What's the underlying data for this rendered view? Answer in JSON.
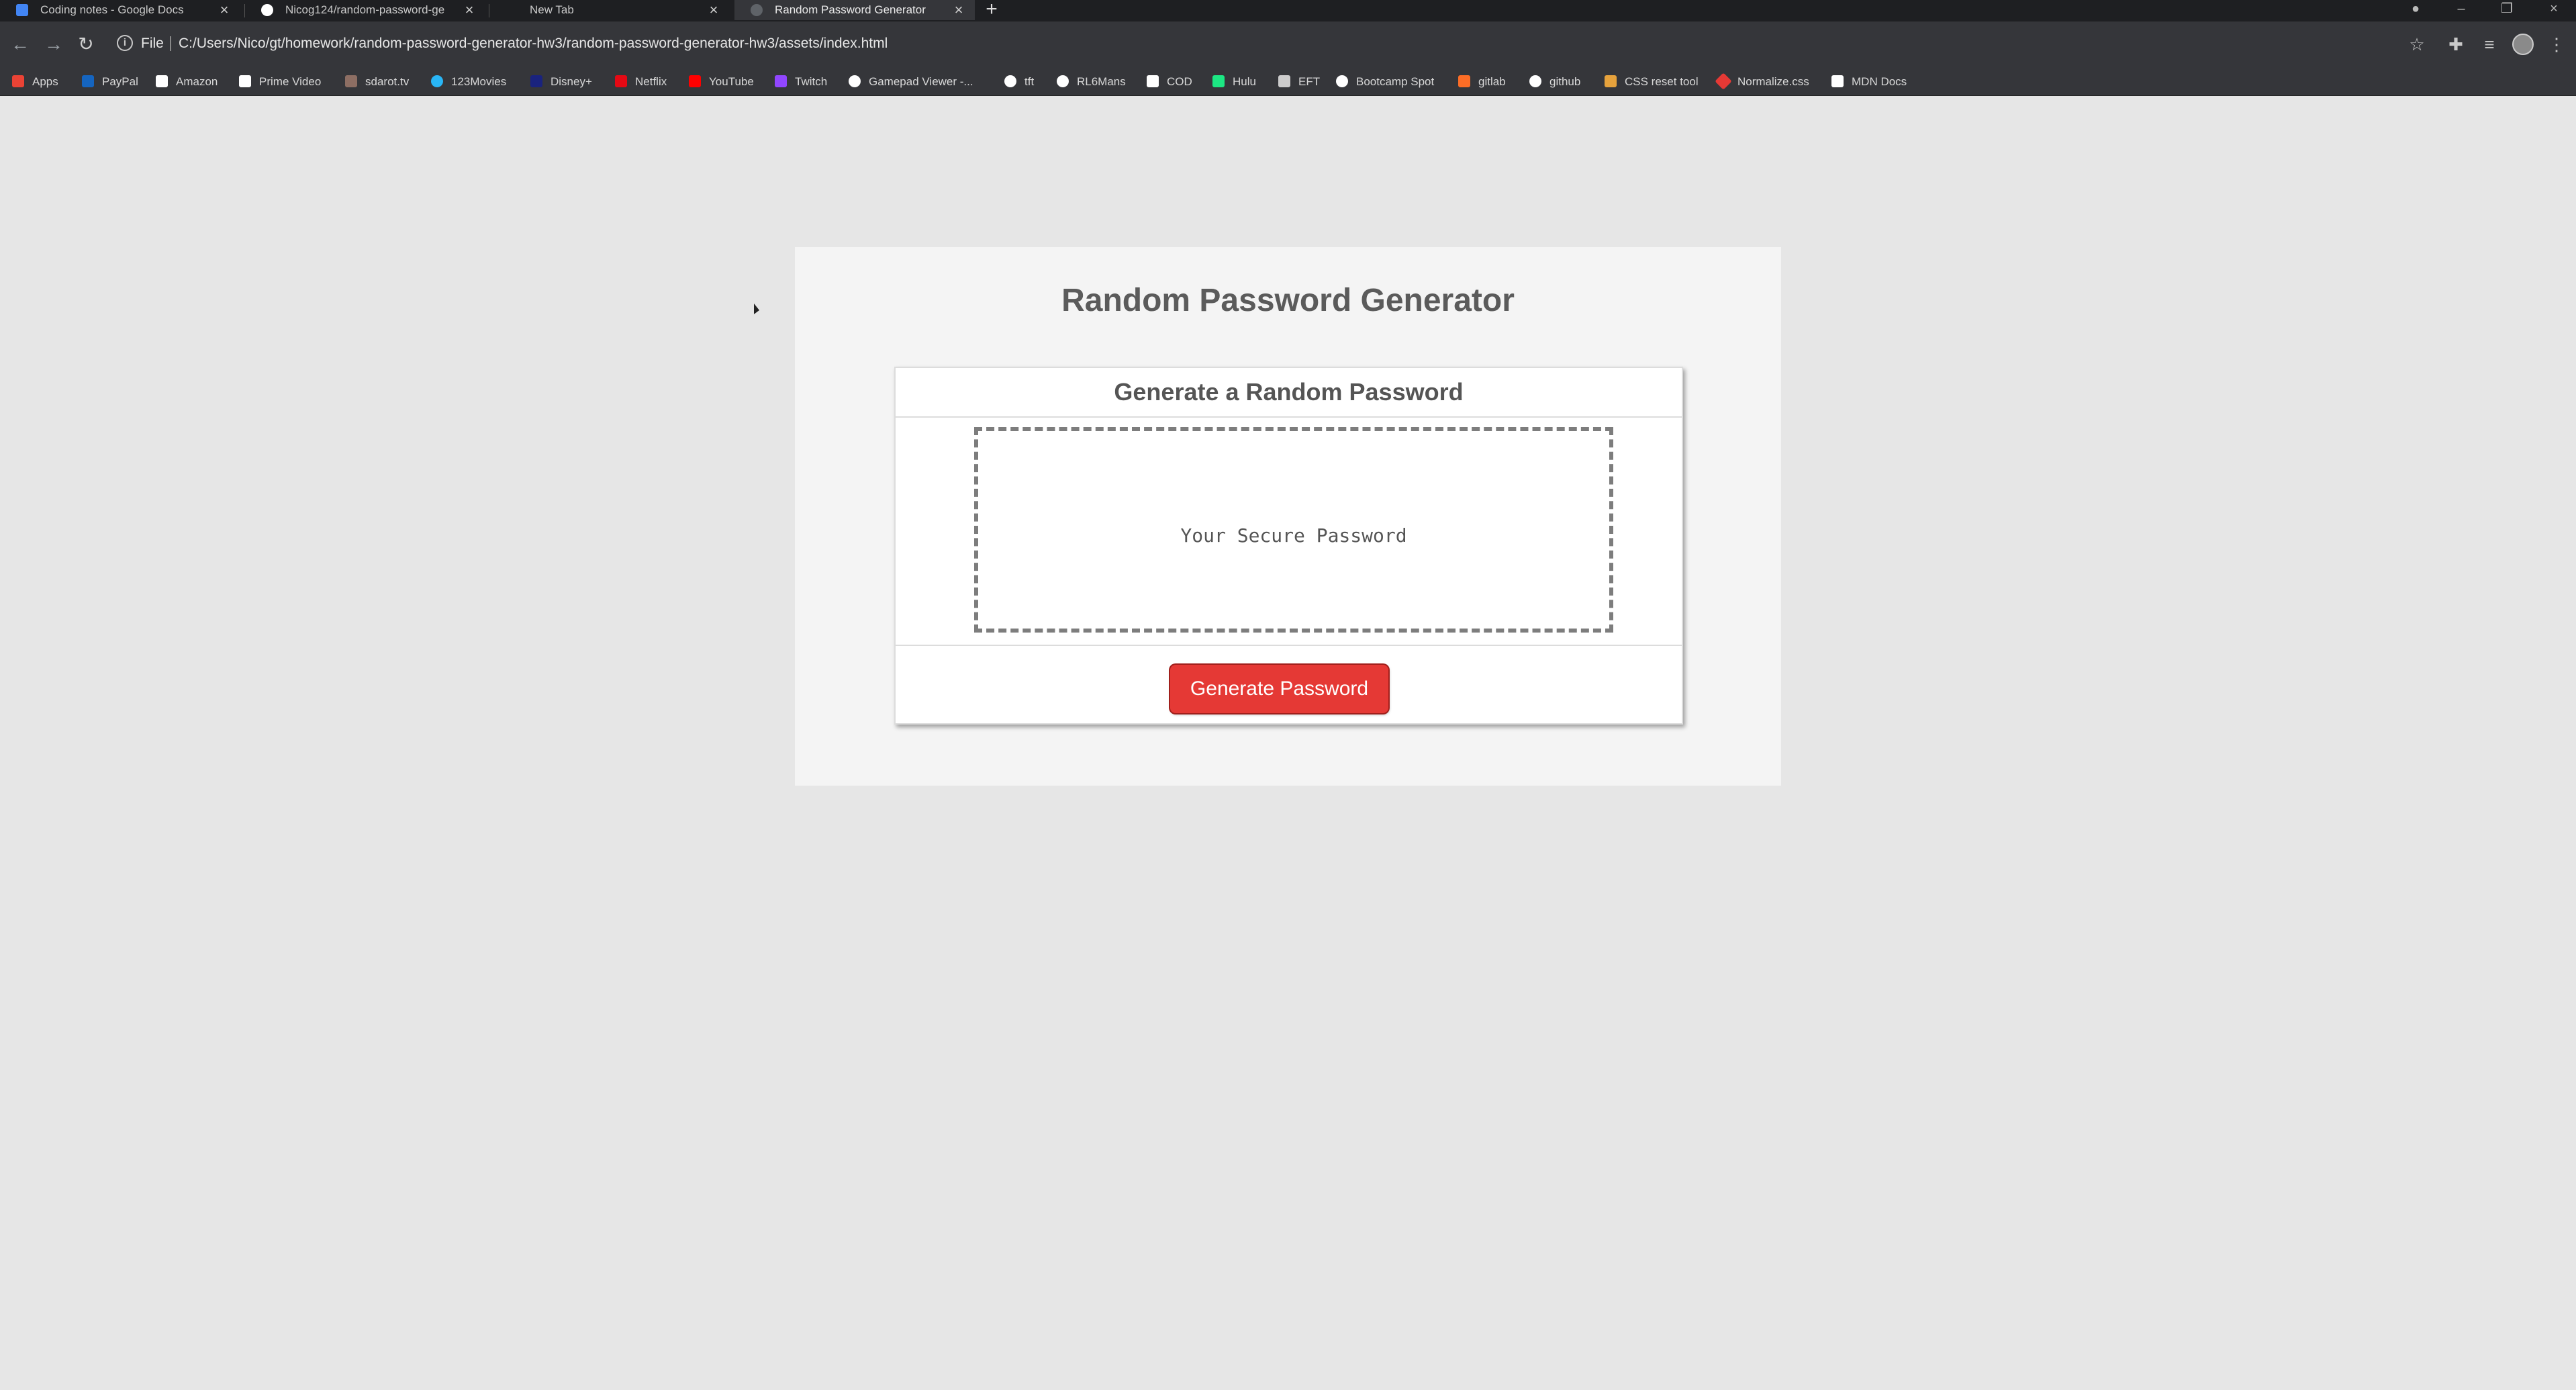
{
  "tabs": [
    {
      "title": "Coding notes - Google Docs",
      "color": "#4285f4"
    },
    {
      "title": "Nicog124/random-password-ge",
      "color": "#ffffff"
    },
    {
      "title": "New Tab",
      "color": "#5f6368"
    },
    {
      "title": "Random Password Generator",
      "color": "#9aa0a6"
    }
  ],
  "address": {
    "label": "File",
    "url": "C:/Users/Nico/gt/homework/random-password-generator-hw3/random-password-generator-hw3/assets/index.html"
  },
  "bookmarks": [
    {
      "label": "Apps",
      "color": "#ea4335"
    },
    {
      "label": "PayPal",
      "color": "#1565c0"
    },
    {
      "label": "Amazon",
      "color": "#ffffff"
    },
    {
      "label": "Prime Video",
      "color": "#ffffff"
    },
    {
      "label": "sdarot.tv",
      "color": "#8d6e63"
    },
    {
      "label": "123Movies",
      "color": "#29b6f6"
    },
    {
      "label": "Disney+",
      "color": "#1a237e"
    },
    {
      "label": "Netflix",
      "color": "#e50914"
    },
    {
      "label": "YouTube",
      "color": "#ff0000"
    },
    {
      "label": "Twitch",
      "color": "#9146ff"
    },
    {
      "label": "Gamepad Viewer -...",
      "color": "#ffffff"
    },
    {
      "label": "tft",
      "color": "#ffffff"
    },
    {
      "label": "RL6Mans",
      "color": "#ffffff"
    },
    {
      "label": "COD",
      "color": "#ffffff"
    },
    {
      "label": "Hulu",
      "color": "#1ce783"
    },
    {
      "label": "EFT",
      "color": "#cccccc"
    },
    {
      "label": "Bootcamp Spot",
      "color": "#ffffff"
    },
    {
      "label": "gitlab",
      "color": "#fc6d26"
    },
    {
      "label": "github",
      "color": "#ffffff"
    },
    {
      "label": "CSS reset tool",
      "color": "#e6a23c"
    },
    {
      "label": "Normalize.css",
      "color": "#e53935"
    },
    {
      "label": "MDN Docs",
      "color": "#ffffff"
    }
  ],
  "page": {
    "title": "Random Password Generator",
    "card_header": "Generate a Random Password",
    "password_placeholder": "Your Secure Password",
    "button_label": "Generate Password",
    "button_color": "#e53935",
    "background": "#e6e6e6"
  }
}
